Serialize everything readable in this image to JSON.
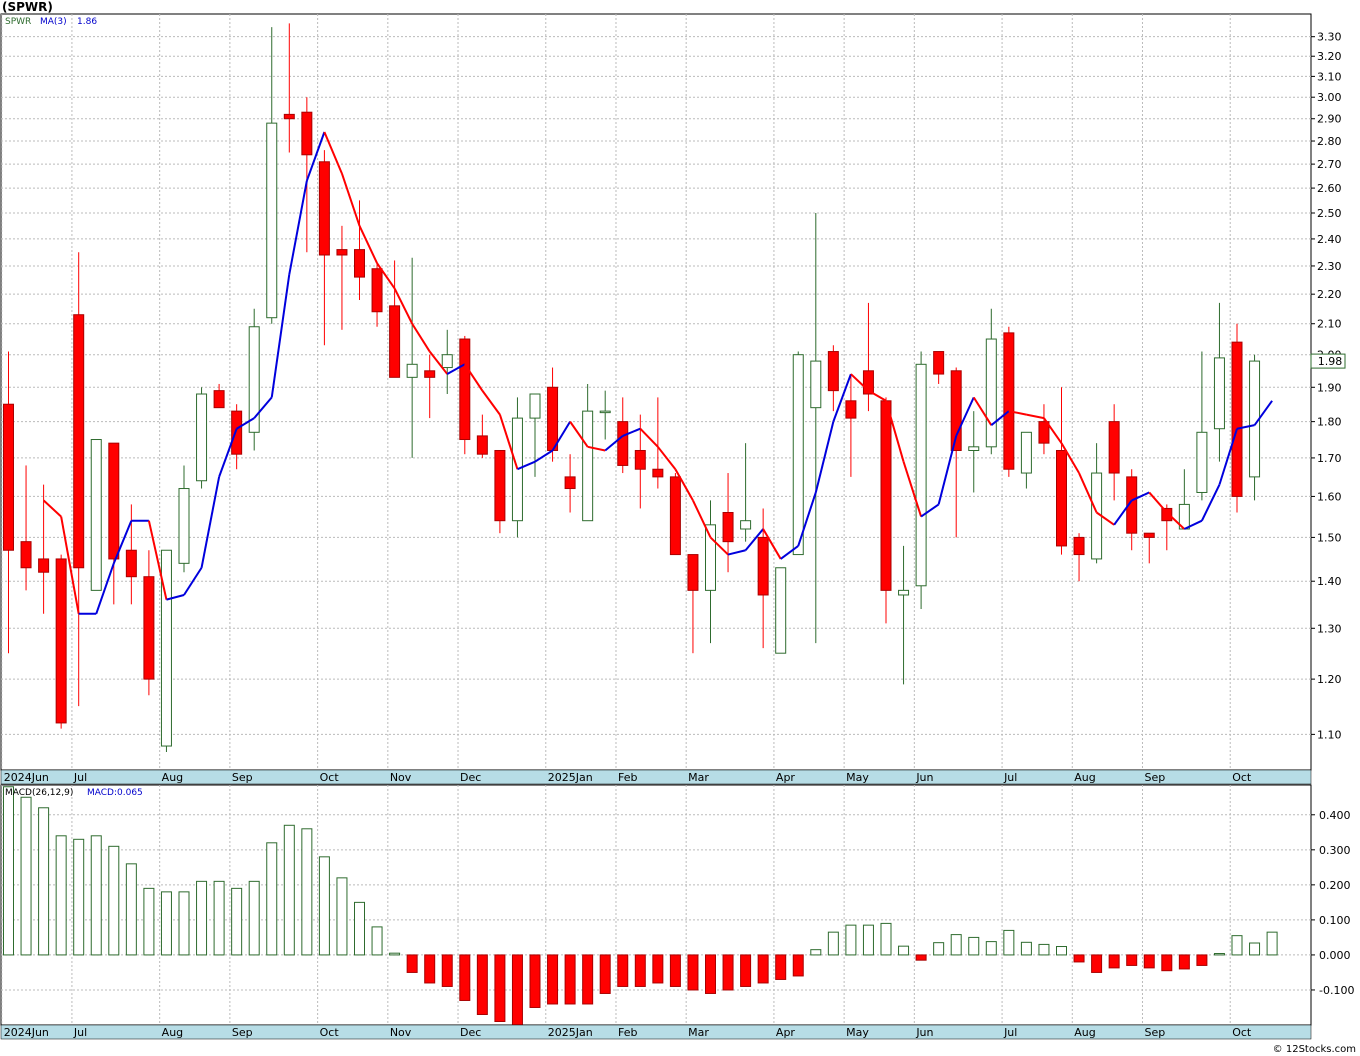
{
  "header": {
    "symbol": "(SPWR)"
  },
  "legend": {
    "symbol": "SPWR",
    "ma_label": "MA(3)",
    "ma_value": "1.86",
    "macd_params": "MACD(26,12,9)",
    "macd_value": "MACD:0.065"
  },
  "last_price_label": "1.98",
  "copyright": "© 12Stocks.com",
  "colors": {
    "up": "#2e6b2e",
    "down": "#ff0000",
    "ma_up": "#0000dd",
    "ma_down": "#ff0000",
    "grid": "#bbbbbb",
    "axis_bar": "#b7dde6"
  },
  "chart_data": [
    {
      "type": "candlestick",
      "title": "(SPWR)",
      "interval": "weekly",
      "y_scale": "log",
      "ylim": [
        1.04,
        3.42
      ],
      "y_ticks": [
        "1.10",
        "1.20",
        "1.30",
        "1.40",
        "1.50",
        "1.60",
        "1.70",
        "1.80",
        "1.90",
        "2.00",
        "2.10",
        "2.20",
        "2.30",
        "2.40",
        "2.50",
        "2.60",
        "2.70",
        "2.80",
        "2.90",
        "3.00",
        "3.10",
        "3.20",
        "3.30"
      ],
      "x_labels": [
        {
          "label": "2024Jun",
          "week": 0
        },
        {
          "label": "Jul",
          "week": 4
        },
        {
          "label": "Aug",
          "week": 9
        },
        {
          "label": "Sep",
          "week": 13
        },
        {
          "label": "Oct",
          "week": 18
        },
        {
          "label": "Nov",
          "week": 22
        },
        {
          "label": "Dec",
          "week": 26
        },
        {
          "label": "2025Jan",
          "week": 31
        },
        {
          "label": "Feb",
          "week": 35
        },
        {
          "label": "Mar",
          "week": 39
        },
        {
          "label": "Apr",
          "week": 44
        },
        {
          "label": "May",
          "week": 48
        },
        {
          "label": "Jun",
          "week": 52
        },
        {
          "label": "Jul",
          "week": 57
        },
        {
          "label": "Aug",
          "week": 61
        },
        {
          "label": "Sep",
          "week": 65
        },
        {
          "label": "Oct",
          "week": 70
        }
      ],
      "candles": [
        [
          1.85,
          2.01,
          1.25,
          1.47
        ],
        [
          1.49,
          1.68,
          1.38,
          1.43
        ],
        [
          1.45,
          1.63,
          1.33,
          1.42
        ],
        [
          1.45,
          1.46,
          1.11,
          1.12
        ],
        [
          2.13,
          2.35,
          1.15,
          1.43
        ],
        [
          1.38,
          1.75,
          1.38,
          1.75
        ],
        [
          1.74,
          1.74,
          1.35,
          1.45
        ],
        [
          1.47,
          1.58,
          1.35,
          1.41
        ],
        [
          1.41,
          1.47,
          1.17,
          1.2
        ],
        [
          1.08,
          1.47,
          1.07,
          1.47
        ],
        [
          1.44,
          1.68,
          1.42,
          1.62
        ],
        [
          1.64,
          1.9,
          1.62,
          1.88
        ],
        [
          1.89,
          1.91,
          1.84,
          1.84
        ],
        [
          1.83,
          1.85,
          1.67,
          1.71
        ],
        [
          1.77,
          2.15,
          1.72,
          2.09
        ],
        [
          2.12,
          3.35,
          2.1,
          2.88
        ],
        [
          2.92,
          3.37,
          2.75,
          2.9
        ],
        [
          2.93,
          3.0,
          2.35,
          2.74
        ],
        [
          2.71,
          2.76,
          2.03,
          2.34
        ],
        [
          2.36,
          2.45,
          2.08,
          2.34
        ],
        [
          2.36,
          2.55,
          2.18,
          2.26
        ],
        [
          2.29,
          2.31,
          2.09,
          2.14
        ],
        [
          2.16,
          2.32,
          1.93,
          1.93
        ],
        [
          1.93,
          2.33,
          1.7,
          1.97
        ],
        [
          1.95,
          2.0,
          1.81,
          1.93
        ],
        [
          1.96,
          2.08,
          1.88,
          2.0
        ],
        [
          2.05,
          2.06,
          1.71,
          1.75
        ],
        [
          1.76,
          1.82,
          1.7,
          1.71
        ],
        [
          1.72,
          1.72,
          1.51,
          1.54
        ],
        [
          1.54,
          1.87,
          1.5,
          1.81
        ],
        [
          1.81,
          1.88,
          1.65,
          1.88
        ],
        [
          1.9,
          1.96,
          1.69,
          1.72
        ],
        [
          1.65,
          1.71,
          1.56,
          1.62
        ],
        [
          1.54,
          1.91,
          1.54,
          1.83
        ],
        [
          1.83,
          1.89,
          1.75,
          1.83
        ],
        [
          1.8,
          1.87,
          1.66,
          1.68
        ],
        [
          1.72,
          1.82,
          1.57,
          1.67
        ],
        [
          1.67,
          1.87,
          1.62,
          1.65
        ],
        [
          1.65,
          1.66,
          1.46,
          1.46
        ],
        [
          1.46,
          1.46,
          1.25,
          1.38
        ],
        [
          1.38,
          1.59,
          1.27,
          1.53
        ],
        [
          1.56,
          1.66,
          1.42,
          1.49
        ],
        [
          1.52,
          1.74,
          1.49,
          1.54
        ],
        [
          1.5,
          1.57,
          1.26,
          1.37
        ],
        [
          1.25,
          1.43,
          1.25,
          1.43
        ],
        [
          1.46,
          2.01,
          1.46,
          2.0
        ],
        [
          1.84,
          2.5,
          1.27,
          1.98
        ],
        [
          2.01,
          2.03,
          1.83,
          1.89
        ],
        [
          1.86,
          1.94,
          1.65,
          1.81
        ],
        [
          1.95,
          2.17,
          1.83,
          1.88
        ],
        [
          1.86,
          1.87,
          1.31,
          1.38
        ],
        [
          1.37,
          1.48,
          1.19,
          1.38
        ],
        [
          1.39,
          2.01,
          1.34,
          1.97
        ],
        [
          2.01,
          2.01,
          1.91,
          1.94
        ],
        [
          1.95,
          1.96,
          1.5,
          1.72
        ],
        [
          1.72,
          1.83,
          1.61,
          1.73
        ],
        [
          1.73,
          2.15,
          1.71,
          2.05
        ],
        [
          2.07,
          2.09,
          1.65,
          1.67
        ],
        [
          1.66,
          1.76,
          1.62,
          1.77
        ],
        [
          1.8,
          1.85,
          1.71,
          1.74
        ],
        [
          1.72,
          1.9,
          1.46,
          1.48
        ],
        [
          1.5,
          1.51,
          1.4,
          1.46
        ],
        [
          1.45,
          1.74,
          1.44,
          1.66
        ],
        [
          1.8,
          1.85,
          1.59,
          1.66
        ],
        [
          1.65,
          1.67,
          1.47,
          1.51
        ],
        [
          1.51,
          1.51,
          1.44,
          1.5
        ],
        [
          1.57,
          1.58,
          1.47,
          1.54
        ],
        [
          1.52,
          1.67,
          1.52,
          1.58
        ],
        [
          1.61,
          2.01,
          1.59,
          1.77
        ],
        [
          1.78,
          2.17,
          1.69,
          1.99
        ],
        [
          2.04,
          2.1,
          1.56,
          1.6
        ],
        [
          1.65,
          2.0,
          1.59,
          1.98
        ]
      ],
      "ma3": [
        null,
        null,
        1.59,
        1.55,
        1.33,
        1.33,
        1.44,
        1.54,
        1.54,
        1.36,
        1.37,
        1.43,
        1.65,
        1.78,
        1.81,
        1.87,
        2.27,
        2.63,
        2.84,
        2.66,
        2.45,
        2.31,
        2.22,
        2.1,
        2.01,
        1.94,
        1.97,
        1.89,
        1.82,
        1.67,
        1.69,
        1.72,
        1.8,
        1.73,
        1.72,
        1.76,
        1.78,
        1.73,
        1.67,
        1.59,
        1.5,
        1.46,
        1.47,
        1.52,
        1.45,
        1.48,
        1.61,
        1.8,
        1.94,
        1.89,
        1.86,
        1.69,
        1.55,
        1.58,
        1.76,
        1.87,
        1.79,
        1.83,
        1.82,
        1.81,
        1.74,
        1.66,
        1.56,
        1.53,
        1.59,
        1.61,
        1.56,
        1.52,
        1.54,
        1.63,
        1.78,
        1.79,
        1.86
      ],
      "last_price": 1.98
    },
    {
      "type": "bar",
      "name": "MACD(26,12,9)",
      "ylim": [
        -0.2,
        0.485
      ],
      "y_ticks": [
        "-0.100",
        "0.000",
        "0.100",
        "0.200",
        "0.300",
        "0.400"
      ],
      "values": [
        0.48,
        0.45,
        0.42,
        0.34,
        0.33,
        0.34,
        0.31,
        0.26,
        0.19,
        0.18,
        0.18,
        0.21,
        0.21,
        0.19,
        0.21,
        0.32,
        0.37,
        0.36,
        0.28,
        0.22,
        0.15,
        0.08,
        0.005,
        -0.05,
        -0.08,
        -0.09,
        -0.13,
        -0.17,
        -0.19,
        -0.2,
        -0.15,
        -0.14,
        -0.14,
        -0.14,
        -0.11,
        -0.09,
        -0.09,
        -0.08,
        -0.09,
        -0.1,
        -0.11,
        -0.1,
        -0.09,
        -0.08,
        -0.07,
        -0.06,
        0.015,
        0.065,
        0.085,
        0.085,
        0.09,
        0.025,
        -0.015,
        0.035,
        0.058,
        0.05,
        0.038,
        0.07,
        0.036,
        0.03,
        0.024,
        -0.02,
        -0.05,
        -0.037,
        -0.03,
        -0.037,
        -0.045,
        -0.04,
        -0.03,
        0.004,
        0.055,
        0.034,
        0.065
      ]
    }
  ]
}
